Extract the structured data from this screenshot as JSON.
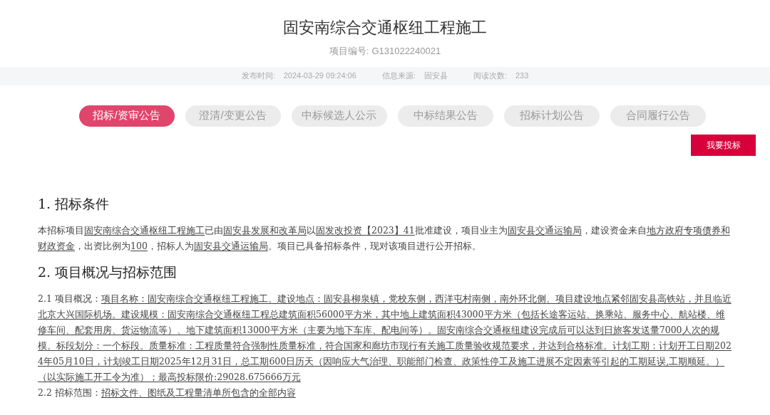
{
  "title": "固安南综合交通枢纽工程施工",
  "project_number": {
    "label": "项目编号:",
    "value": "G131022240021"
  },
  "meta": [
    {
      "label": "发布时间:",
      "value": "2024-03-29 09:24:06"
    },
    {
      "label": "信息来源:",
      "value": "固安县"
    },
    {
      "label": "阅读次数:",
      "value": "233"
    }
  ],
  "tabs": [
    {
      "label": "招标/资审公告",
      "selected": true
    },
    {
      "label": "澄清/变更公告",
      "selected": false
    },
    {
      "label": "中标候选人公示",
      "selected": false
    },
    {
      "label": "中标结果公告",
      "selected": false
    },
    {
      "label": "招标计划公告",
      "selected": false
    },
    {
      "label": "合同履行公告",
      "selected": false
    }
  ],
  "bid_button": "我要投标",
  "sections": [
    {
      "heading": "1. 招标条件",
      "paragraphs": [
        {
          "segments": [
            {
              "text": "本招标项目",
              "underlined": false
            },
            {
              "text": "固安南综合交通枢纽工程施工",
              "underlined": true
            },
            {
              "text": "已由",
              "underlined": false
            },
            {
              "text": "固安县发展和改革局",
              "underlined": true
            },
            {
              "text": "以",
              "underlined": false
            },
            {
              "text": "固发改投资【2023】41",
              "underlined": true
            },
            {
              "text": "批准建设，项目业主为",
              "underlined": false
            },
            {
              "text": "固安县交通运输局",
              "underlined": true
            },
            {
              "text": "，建设资金来自",
              "underlined": false
            },
            {
              "text": "地方政府专项债券和财政资金",
              "underlined": true
            },
            {
              "text": "，出资比例为",
              "underlined": false
            },
            {
              "text": "100",
              "underlined": true
            },
            {
              "text": "，招标人为",
              "underlined": false
            },
            {
              "text": "固安县交通运输局",
              "underlined": true
            },
            {
              "text": "。项目已具备招标条件，现对该项目进行公开招标。",
              "underlined": false
            }
          ]
        }
      ]
    },
    {
      "heading": "2. 项目概况与招标范围",
      "paragraphs": [
        {
          "segments": [
            {
              "text": "2.1 项目概况：",
              "underlined": false
            },
            {
              "text": "项目名称：固安南综合交通枢纽工程施工。建设地点：固安县柳泉镇，党校东侧，西洋屯村南侧，南外环北侧。项目建设地点紧邻固安县高铁站，并且临近北京大兴国际机场。建设规模：固安南综合交通枢纽工程总建筑面积56000平方米，其中地上建筑面积43000平方米（包括长途客运站、换乘站、服务中心、航站楼、维修车间、配套用房、货运物流等）、地下建筑面积13000平方米（主要为地下车库、配电间等）。固安南综合交通枢纽建设完成后可以达到日旅客发送量7000人次的规模。标段划分：一个标段。质量标准：工程质量符合强制性质量标准，符合国家和廊坊市现行有关施工质量验收规范要求，并达到合格标准。计划工期：计划开工日期2024年05月10日，计划竣工日期2025年12月31日，总工期600日历天（因响应大气治理、职能部门检查、政策性停工及施工进展不定因素等引起的工期延误,工期顺延。）（以实际施工开工令为准）；最高投标限价:29028.675666万元",
              "underlined": true
            }
          ]
        },
        {
          "segments": [
            {
              "text": "2.2 招标范围：",
              "underlined": false
            },
            {
              "text": "招标文件、图纸及工程量清单所包含的全部内容",
              "underlined": true
            }
          ]
        }
      ]
    }
  ]
}
